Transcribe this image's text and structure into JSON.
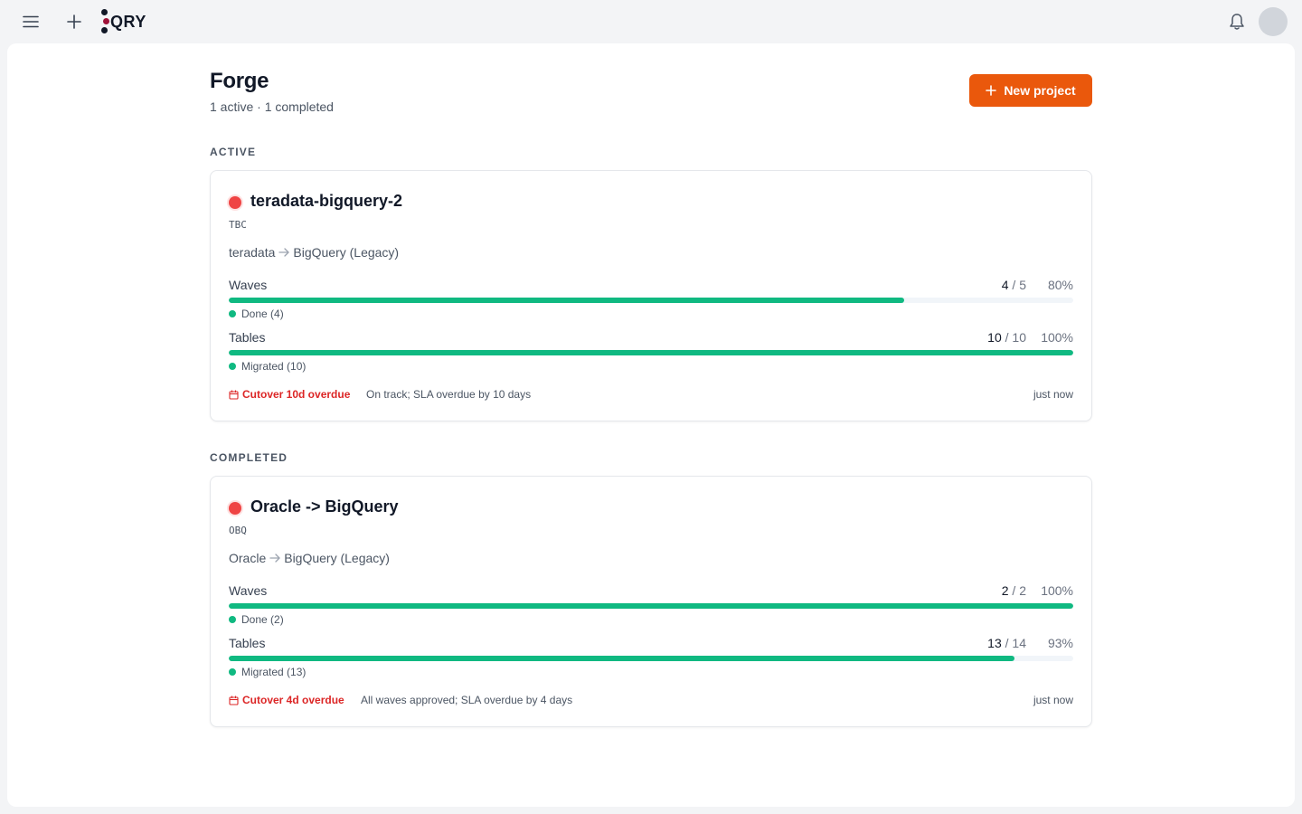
{
  "topbar": {
    "menu_icon": "menu-icon",
    "add_icon": "plus-icon",
    "logo_text": "QRY",
    "bell_icon": "bell-icon"
  },
  "page": {
    "title": "Forge",
    "subtitle": "1 active · 1 completed",
    "new_project_label": "New project"
  },
  "sections": {
    "active_label": "ACTIVE",
    "completed_label": "COMPLETED"
  },
  "projects": [
    {
      "name": "teradata-bigquery-2",
      "code": "TBC",
      "source": "teradata",
      "target": "BigQuery (Legacy)",
      "status_color": "#ef4444",
      "waves": {
        "label": "Waves",
        "done": "4",
        "total": "/ 5",
        "percent": "80%",
        "fraction": 0.8,
        "legend": "Done (4)"
      },
      "tables": {
        "label": "Tables",
        "done": "10",
        "total": "/ 10",
        "percent": "100%",
        "fraction": 1.0,
        "legend": "Migrated (10)"
      },
      "cutover": "Cutover 10d overdue",
      "note": "On track; SLA overdue by 10 days",
      "updated": "just now"
    },
    {
      "name": "Oracle -> BigQuery",
      "code": "OBQ",
      "source": "Oracle",
      "target": "BigQuery (Legacy)",
      "status_color": "#ef4444",
      "waves": {
        "label": "Waves",
        "done": "2",
        "total": "/ 2",
        "percent": "100%",
        "fraction": 1.0,
        "legend": "Done (2)"
      },
      "tables": {
        "label": "Tables",
        "done": "13",
        "total": "/ 14",
        "percent": "93%",
        "fraction": 0.93,
        "legend": "Migrated (13)"
      },
      "cutover": "Cutover 4d overdue",
      "note": "All waves approved; SLA overdue by 4 days",
      "updated": "just now"
    }
  ],
  "colors": {
    "accent": "#ea580c",
    "progress": "#10b981",
    "danger": "#dc2626"
  }
}
